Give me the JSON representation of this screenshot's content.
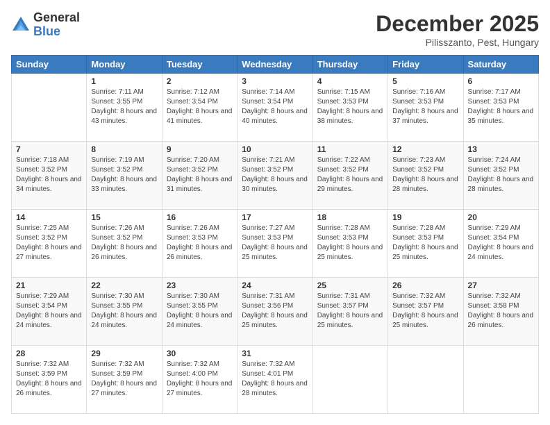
{
  "logo": {
    "general": "General",
    "blue": "Blue"
  },
  "header": {
    "month": "December 2025",
    "location": "Pilisszanto, Pest, Hungary"
  },
  "weekdays": [
    "Sunday",
    "Monday",
    "Tuesday",
    "Wednesday",
    "Thursday",
    "Friday",
    "Saturday"
  ],
  "weeks": [
    [
      {
        "day": "",
        "sunrise": "",
        "sunset": "",
        "daylight": ""
      },
      {
        "day": "1",
        "sunrise": "Sunrise: 7:11 AM",
        "sunset": "Sunset: 3:55 PM",
        "daylight": "Daylight: 8 hours and 43 minutes."
      },
      {
        "day": "2",
        "sunrise": "Sunrise: 7:12 AM",
        "sunset": "Sunset: 3:54 PM",
        "daylight": "Daylight: 8 hours and 41 minutes."
      },
      {
        "day": "3",
        "sunrise": "Sunrise: 7:14 AM",
        "sunset": "Sunset: 3:54 PM",
        "daylight": "Daylight: 8 hours and 40 minutes."
      },
      {
        "day": "4",
        "sunrise": "Sunrise: 7:15 AM",
        "sunset": "Sunset: 3:53 PM",
        "daylight": "Daylight: 8 hours and 38 minutes."
      },
      {
        "day": "5",
        "sunrise": "Sunrise: 7:16 AM",
        "sunset": "Sunset: 3:53 PM",
        "daylight": "Daylight: 8 hours and 37 minutes."
      },
      {
        "day": "6",
        "sunrise": "Sunrise: 7:17 AM",
        "sunset": "Sunset: 3:53 PM",
        "daylight": "Daylight: 8 hours and 35 minutes."
      }
    ],
    [
      {
        "day": "7",
        "sunrise": "Sunrise: 7:18 AM",
        "sunset": "Sunset: 3:52 PM",
        "daylight": "Daylight: 8 hours and 34 minutes."
      },
      {
        "day": "8",
        "sunrise": "Sunrise: 7:19 AM",
        "sunset": "Sunset: 3:52 PM",
        "daylight": "Daylight: 8 hours and 33 minutes."
      },
      {
        "day": "9",
        "sunrise": "Sunrise: 7:20 AM",
        "sunset": "Sunset: 3:52 PM",
        "daylight": "Daylight: 8 hours and 31 minutes."
      },
      {
        "day": "10",
        "sunrise": "Sunrise: 7:21 AM",
        "sunset": "Sunset: 3:52 PM",
        "daylight": "Daylight: 8 hours and 30 minutes."
      },
      {
        "day": "11",
        "sunrise": "Sunrise: 7:22 AM",
        "sunset": "Sunset: 3:52 PM",
        "daylight": "Daylight: 8 hours and 29 minutes."
      },
      {
        "day": "12",
        "sunrise": "Sunrise: 7:23 AM",
        "sunset": "Sunset: 3:52 PM",
        "daylight": "Daylight: 8 hours and 28 minutes."
      },
      {
        "day": "13",
        "sunrise": "Sunrise: 7:24 AM",
        "sunset": "Sunset: 3:52 PM",
        "daylight": "Daylight: 8 hours and 28 minutes."
      }
    ],
    [
      {
        "day": "14",
        "sunrise": "Sunrise: 7:25 AM",
        "sunset": "Sunset: 3:52 PM",
        "daylight": "Daylight: 8 hours and 27 minutes."
      },
      {
        "day": "15",
        "sunrise": "Sunrise: 7:26 AM",
        "sunset": "Sunset: 3:52 PM",
        "daylight": "Daylight: 8 hours and 26 minutes."
      },
      {
        "day": "16",
        "sunrise": "Sunrise: 7:26 AM",
        "sunset": "Sunset: 3:53 PM",
        "daylight": "Daylight: 8 hours and 26 minutes."
      },
      {
        "day": "17",
        "sunrise": "Sunrise: 7:27 AM",
        "sunset": "Sunset: 3:53 PM",
        "daylight": "Daylight: 8 hours and 25 minutes."
      },
      {
        "day": "18",
        "sunrise": "Sunrise: 7:28 AM",
        "sunset": "Sunset: 3:53 PM",
        "daylight": "Daylight: 8 hours and 25 minutes."
      },
      {
        "day": "19",
        "sunrise": "Sunrise: 7:28 AM",
        "sunset": "Sunset: 3:53 PM",
        "daylight": "Daylight: 8 hours and 25 minutes."
      },
      {
        "day": "20",
        "sunrise": "Sunrise: 7:29 AM",
        "sunset": "Sunset: 3:54 PM",
        "daylight": "Daylight: 8 hours and 24 minutes."
      }
    ],
    [
      {
        "day": "21",
        "sunrise": "Sunrise: 7:29 AM",
        "sunset": "Sunset: 3:54 PM",
        "daylight": "Daylight: 8 hours and 24 minutes."
      },
      {
        "day": "22",
        "sunrise": "Sunrise: 7:30 AM",
        "sunset": "Sunset: 3:55 PM",
        "daylight": "Daylight: 8 hours and 24 minutes."
      },
      {
        "day": "23",
        "sunrise": "Sunrise: 7:30 AM",
        "sunset": "Sunset: 3:55 PM",
        "daylight": "Daylight: 8 hours and 24 minutes."
      },
      {
        "day": "24",
        "sunrise": "Sunrise: 7:31 AM",
        "sunset": "Sunset: 3:56 PM",
        "daylight": "Daylight: 8 hours and 25 minutes."
      },
      {
        "day": "25",
        "sunrise": "Sunrise: 7:31 AM",
        "sunset": "Sunset: 3:57 PM",
        "daylight": "Daylight: 8 hours and 25 minutes."
      },
      {
        "day": "26",
        "sunrise": "Sunrise: 7:32 AM",
        "sunset": "Sunset: 3:57 PM",
        "daylight": "Daylight: 8 hours and 25 minutes."
      },
      {
        "day": "27",
        "sunrise": "Sunrise: 7:32 AM",
        "sunset": "Sunset: 3:58 PM",
        "daylight": "Daylight: 8 hours and 26 minutes."
      }
    ],
    [
      {
        "day": "28",
        "sunrise": "Sunrise: 7:32 AM",
        "sunset": "Sunset: 3:59 PM",
        "daylight": "Daylight: 8 hours and 26 minutes."
      },
      {
        "day": "29",
        "sunrise": "Sunrise: 7:32 AM",
        "sunset": "Sunset: 3:59 PM",
        "daylight": "Daylight: 8 hours and 27 minutes."
      },
      {
        "day": "30",
        "sunrise": "Sunrise: 7:32 AM",
        "sunset": "Sunset: 4:00 PM",
        "daylight": "Daylight: 8 hours and 27 minutes."
      },
      {
        "day": "31",
        "sunrise": "Sunrise: 7:32 AM",
        "sunset": "Sunset: 4:01 PM",
        "daylight": "Daylight: 8 hours and 28 minutes."
      },
      {
        "day": "",
        "sunrise": "",
        "sunset": "",
        "daylight": ""
      },
      {
        "day": "",
        "sunrise": "",
        "sunset": "",
        "daylight": ""
      },
      {
        "day": "",
        "sunrise": "",
        "sunset": "",
        "daylight": ""
      }
    ]
  ]
}
